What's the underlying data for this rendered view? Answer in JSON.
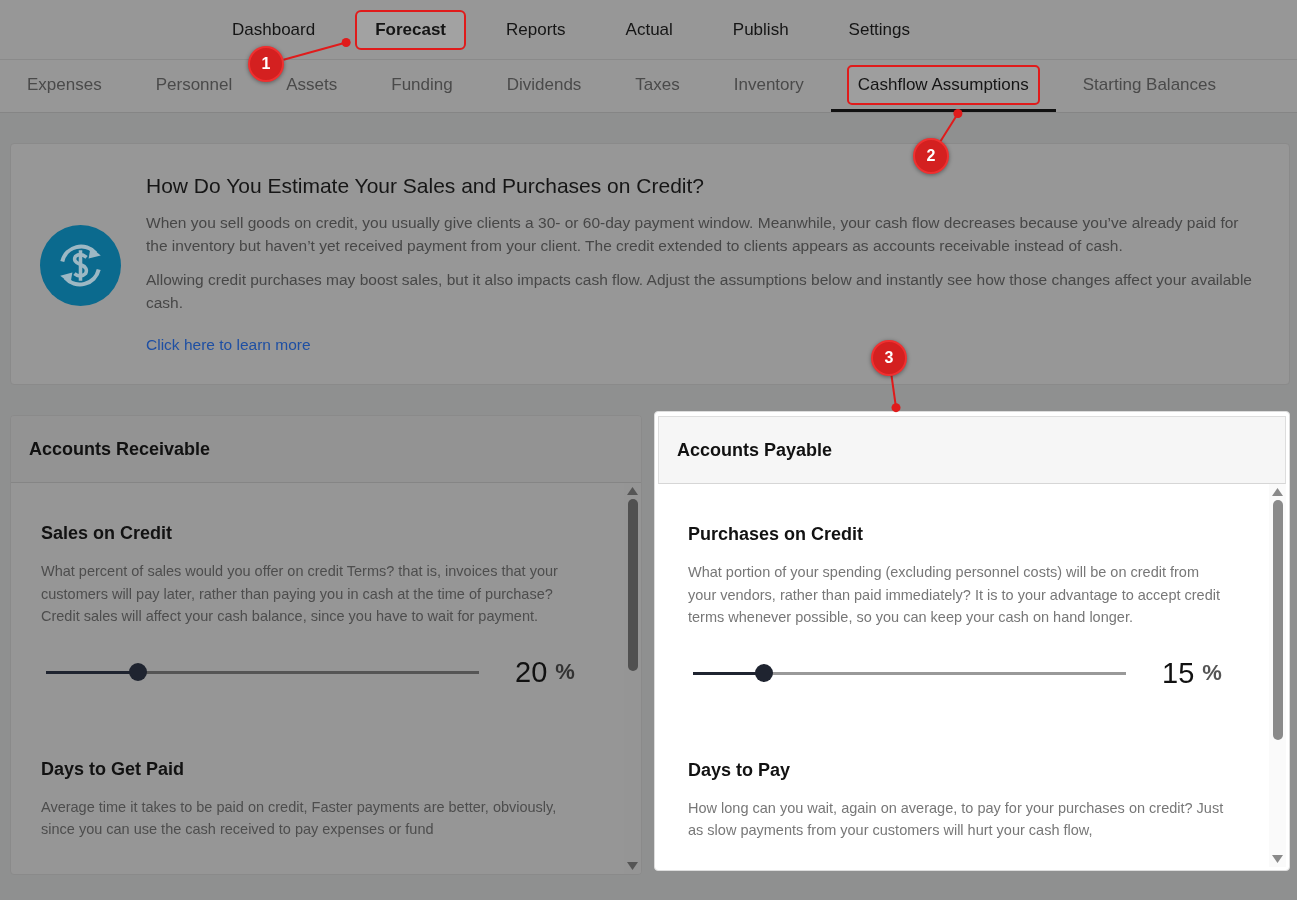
{
  "main_tabs": [
    {
      "label": "Dashboard",
      "selected": false,
      "annotated": false
    },
    {
      "label": "Forecast",
      "selected": true,
      "annotated": true
    },
    {
      "label": "Reports",
      "selected": false,
      "annotated": false
    },
    {
      "label": "Actual",
      "selected": false,
      "annotated": false
    },
    {
      "label": "Publish",
      "selected": false,
      "annotated": false
    },
    {
      "label": "Settings",
      "selected": false,
      "annotated": false
    }
  ],
  "sub_tabs": [
    {
      "label": "Expenses",
      "selected": false,
      "annotated": false
    },
    {
      "label": "Personnel",
      "selected": false,
      "annotated": false
    },
    {
      "label": "Assets",
      "selected": false,
      "annotated": false
    },
    {
      "label": "Funding",
      "selected": false,
      "annotated": false
    },
    {
      "label": "Dividends",
      "selected": false,
      "annotated": false
    },
    {
      "label": "Taxes",
      "selected": false,
      "annotated": false
    },
    {
      "label": "Inventory",
      "selected": false,
      "annotated": false
    },
    {
      "label": "Cashflow Assumptions",
      "selected": true,
      "annotated": true
    },
    {
      "label": "Starting Balances",
      "selected": false,
      "annotated": false
    }
  ],
  "info_card": {
    "title": "How Do You Estimate Your Sales and Purchases on Credit?",
    "paragraphs": [
      "When you sell goods on credit, you usually give clients a 30- or 60-day payment window. Meanwhile, your cash flow decreases because you’ve already paid for the inventory but haven’t yet received payment from your client. The credit extended to clients appears as accounts receivable instead of cash.",
      "Allowing credit purchases may boost sales, but it also impacts cash flow. Adjust the assumptions below and instantly see how those changes affect your available cash."
    ],
    "link": "Click here to learn more"
  },
  "panels": [
    {
      "title": "Accounts Receivable",
      "highlighted": false,
      "sections": [
        {
          "kind": "slider",
          "title": "Sales on Credit",
          "description": "What percent of sales would you offer on credit Terms? that is, invoices that your customers will pay later, rather than paying you in cash at the time of purchase? Credit sales will affect your cash balance, since you have to wait for payment.",
          "level": 0.2,
          "value": "20",
          "unit": "%"
        },
        {
          "kind": "text",
          "title": "Days to Get Paid",
          "description": "Average time it takes to be paid on credit, Faster payments are better, obviously, since you can use the cash received to pay expenses or fund"
        }
      ]
    },
    {
      "title": "Accounts Payable",
      "highlighted": true,
      "sections": [
        {
          "kind": "slider",
          "title": "Purchases on Credit",
          "description": "What portion of your spending (excluding personnel costs) will be on credit from your vendors, rather than paid immediately? It is to your advantage to accept credit terms whenever possible, so you can keep your cash on hand longer.",
          "level": 0.15,
          "value": "15",
          "unit": "%"
        },
        {
          "kind": "text",
          "title": "Days to Pay",
          "description": "How long can you wait, again on average, to pay for your purchases on credit? Just as slow payments from your customers will hurt your cash flow,"
        }
      ]
    }
  ],
  "callouts": [
    {
      "number": "1"
    },
    {
      "number": "2"
    },
    {
      "number": "3"
    }
  ]
}
